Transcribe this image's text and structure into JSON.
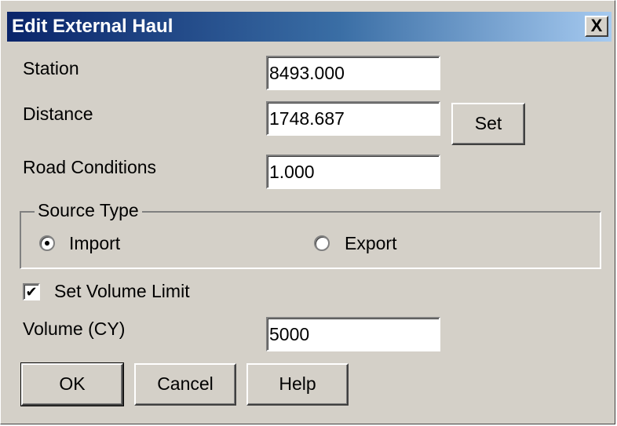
{
  "dialog": {
    "title": "Edit External Haul",
    "close_glyph": "X"
  },
  "fields": {
    "station": {
      "label": "Station",
      "value": "8493.000"
    },
    "distance": {
      "label": "Distance",
      "value": "1748.687",
      "set_label": "Set"
    },
    "road_conditions": {
      "label": "Road Conditions",
      "value": "1.000"
    },
    "volume": {
      "label": "Volume (CY)",
      "value": "5000"
    }
  },
  "source_type": {
    "legend": "Source Type",
    "options": [
      {
        "label": "Import",
        "selected": true
      },
      {
        "label": "Export",
        "selected": false
      }
    ]
  },
  "volume_limit": {
    "label": "Set Volume Limit",
    "checked": true,
    "check_glyph": "✔"
  },
  "buttons": {
    "ok": "OK",
    "cancel": "Cancel",
    "help": "Help"
  },
  "colors": {
    "face": "#d4d0c8",
    "title_start": "#0a246a",
    "title_end": "#a6caf0"
  }
}
